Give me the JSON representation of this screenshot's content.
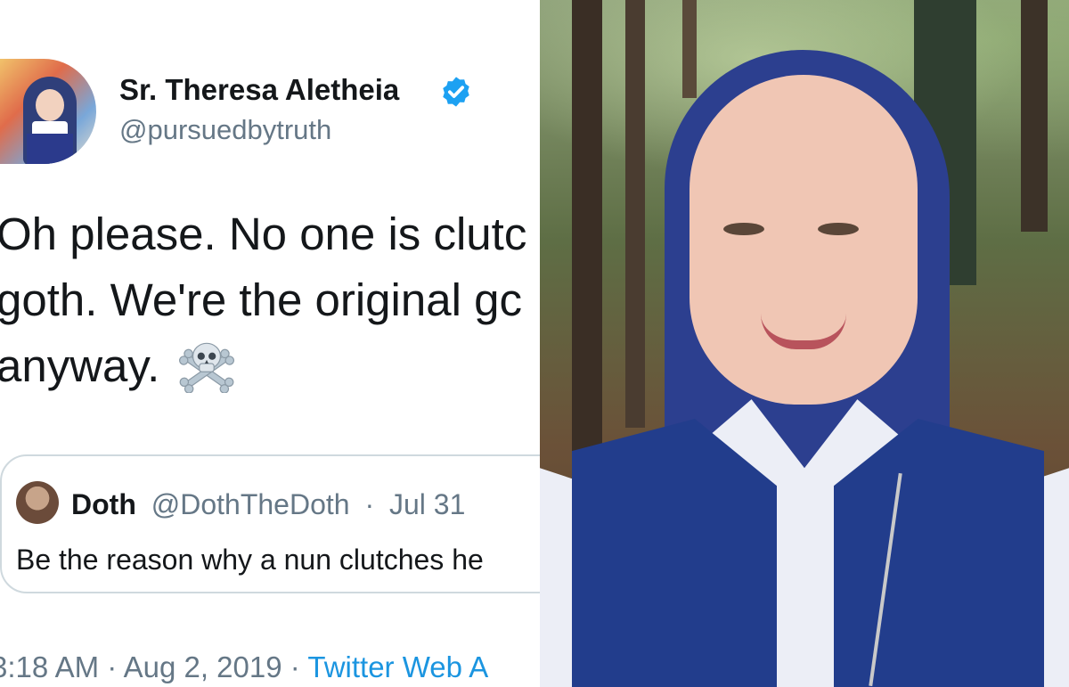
{
  "tweet": {
    "author": {
      "display_name": "Sr. Theresa Aletheia",
      "handle": "@pursuedbytruth",
      "verified": true
    },
    "text_lines": [
      "Oh please. No one is clutc",
      "goth. We're the original gc",
      "anyway."
    ],
    "emoji_icon": "skull-and-crossbones-icon",
    "quoted_tweet": {
      "name": "Doth",
      "handle": "@DothTheDoth",
      "separator": "·",
      "date": "Jul 31",
      "text": "Be the reason why a nun clutches he"
    },
    "timestamp": {
      "time": "3:18 AM",
      "date": "Aug 2, 2019",
      "separator": "·",
      "source": "Twitter Web A"
    }
  },
  "colors": {
    "text_primary": "#14171a",
    "text_secondary": "#657786",
    "link": "#1b95e0",
    "verified_badge": "#1da1f2",
    "quote_border": "#cfd9de"
  },
  "photo": {
    "subject": "nun-portrait-photo"
  }
}
